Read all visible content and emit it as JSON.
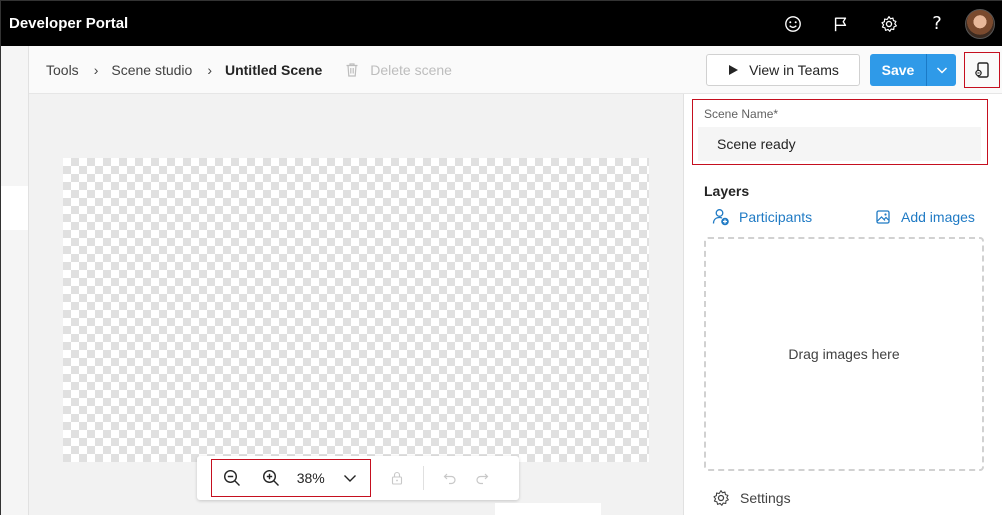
{
  "app": {
    "title": "Developer Portal"
  },
  "header_icons": [
    {
      "name": "feedback-smiley-icon"
    },
    {
      "name": "flag-icon"
    },
    {
      "name": "gear-icon"
    },
    {
      "name": "help-icon",
      "glyph": "?"
    },
    {
      "name": "avatar"
    }
  ],
  "breadcrumb": {
    "items": [
      "Tools",
      "Scene studio",
      "Untitled Scene"
    ],
    "separator": "›"
  },
  "toolbar": {
    "delete_label": "Delete scene",
    "view_in_teams_label": "View in Teams",
    "save_label": "Save"
  },
  "zoom": {
    "value": "38%"
  },
  "scene_panel": {
    "name_label": "Scene Name*",
    "name_value": "Scene ready",
    "layers_title": "Layers",
    "participants_label": "Participants",
    "add_images_label": "Add images",
    "drop_hint": "Drag images here",
    "settings_label": "Settings"
  },
  "colors": {
    "accent": "#2f9ae8",
    "link": "#1f7ac4",
    "highlight_border": "#c50f1f",
    "topbar_bg": "#000000"
  }
}
